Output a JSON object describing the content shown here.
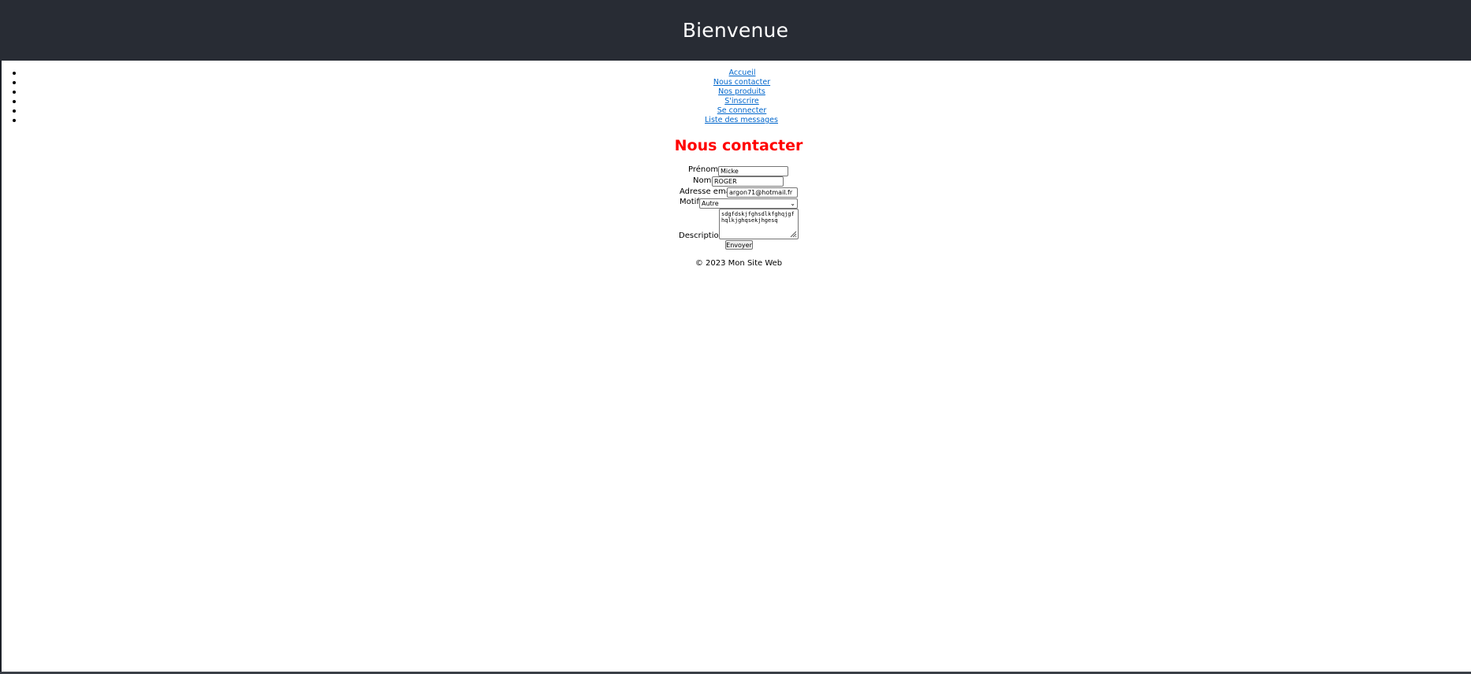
{
  "header": {
    "title": "Bienvenue",
    "background_color": "#282c34"
  },
  "nav": {
    "items": [
      {
        "label": "Accueil"
      },
      {
        "label": "Nous contacter"
      },
      {
        "label": "Nos produits"
      },
      {
        "label": "S'inscrire"
      },
      {
        "label": "Se connecter"
      },
      {
        "label": "Liste des messages"
      }
    ],
    "link_color": "#0066cc"
  },
  "contact": {
    "title": "Nous contacter",
    "title_color": "#ff0000",
    "prenom": {
      "label": "Prénom:",
      "value": "Micke"
    },
    "nom": {
      "label": "Nom:",
      "value": "ROGER"
    },
    "email": {
      "label": "Adresse email:",
      "value": "argon71@hotmail.fr"
    },
    "motif": {
      "label": "Motif:",
      "value": "Autre"
    },
    "description": {
      "label": "Description:",
      "value": "sdgfdskjfghsdlkfghqjgfhqlkjghqsekjhgesq"
    },
    "submit_label": "Envoyer"
  },
  "footer": {
    "text": "© 2023 Mon Site Web"
  }
}
